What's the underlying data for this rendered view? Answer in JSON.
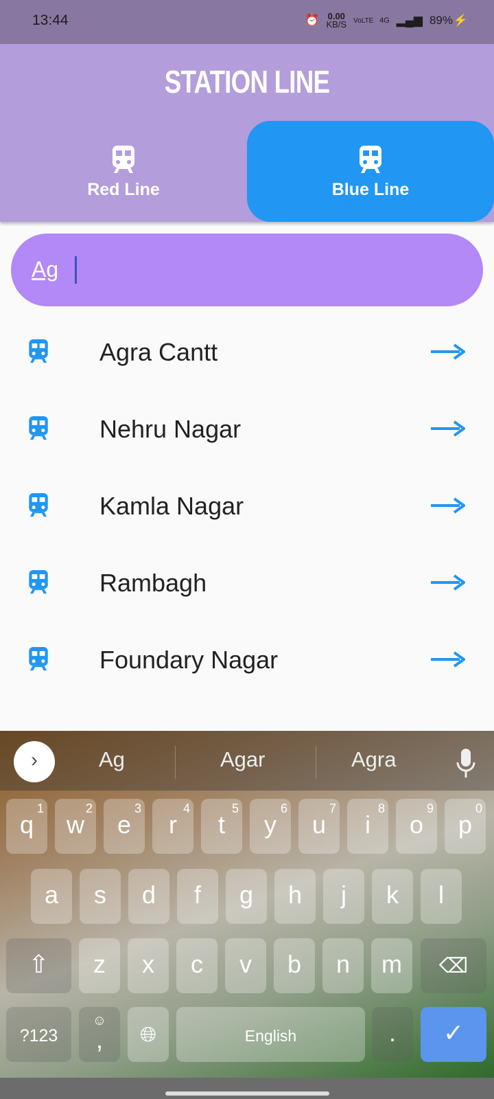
{
  "status": {
    "time": "13:44",
    "net_speed": "0.00",
    "net_unit": "KB/S",
    "volte": "VoLTE",
    "network": "4G",
    "battery": "89%",
    "icons": [
      "alarm-icon",
      "signal-icon",
      "charging-icon"
    ]
  },
  "header": {
    "title": "STATION LINE",
    "tabs": [
      {
        "label": "Red Line",
        "icon": "train-icon",
        "selected": false
      },
      {
        "label": "Blue Line",
        "icon": "train-icon",
        "selected": true
      }
    ]
  },
  "search": {
    "value": "Ag"
  },
  "stations": [
    {
      "name": "Agra Cantt"
    },
    {
      "name": "Nehru Nagar"
    },
    {
      "name": "Kamla Nagar"
    },
    {
      "name": "Rambagh"
    },
    {
      "name": "Foundary Nagar"
    }
  ],
  "colors": {
    "accent": "#2196f3",
    "header": "#b39ddb",
    "search": "#b388f7"
  },
  "keyboard": {
    "suggestions": [
      "Ag",
      "Agar",
      "Agra"
    ],
    "row1": [
      [
        "q",
        "1"
      ],
      [
        "w",
        "2"
      ],
      [
        "e",
        "3"
      ],
      [
        "r",
        "4"
      ],
      [
        "t",
        "5"
      ],
      [
        "y",
        "6"
      ],
      [
        "u",
        "7"
      ],
      [
        "i",
        "8"
      ],
      [
        "o",
        "9"
      ],
      [
        "p",
        "0"
      ]
    ],
    "row2": [
      "a",
      "s",
      "d",
      "f",
      "g",
      "h",
      "j",
      "k",
      "l"
    ],
    "row3": [
      "z",
      "x",
      "c",
      "v",
      "b",
      "n",
      "m"
    ],
    "symbols": "?123",
    "comma": ",",
    "space": "English",
    "period": "."
  }
}
